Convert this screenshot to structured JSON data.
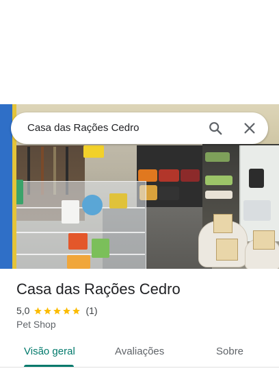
{
  "search": {
    "query": "Casa das Rações Cedro"
  },
  "place": {
    "name": "Casa das Rações Cedro",
    "rating": "5,0",
    "stars": 5,
    "review_count": "(1)",
    "category": "Pet Shop"
  },
  "tabs": [
    {
      "label": "Visão geral",
      "active": true
    },
    {
      "label": "Avaliações",
      "active": false
    },
    {
      "label": "Sobre",
      "active": false
    }
  ],
  "colors": {
    "accent": "#00796b",
    "star": "#fbbc04",
    "text_primary": "#202124",
    "text_secondary": "#5f6368"
  },
  "icons": [
    "search-icon",
    "close-icon",
    "star-icon"
  ]
}
